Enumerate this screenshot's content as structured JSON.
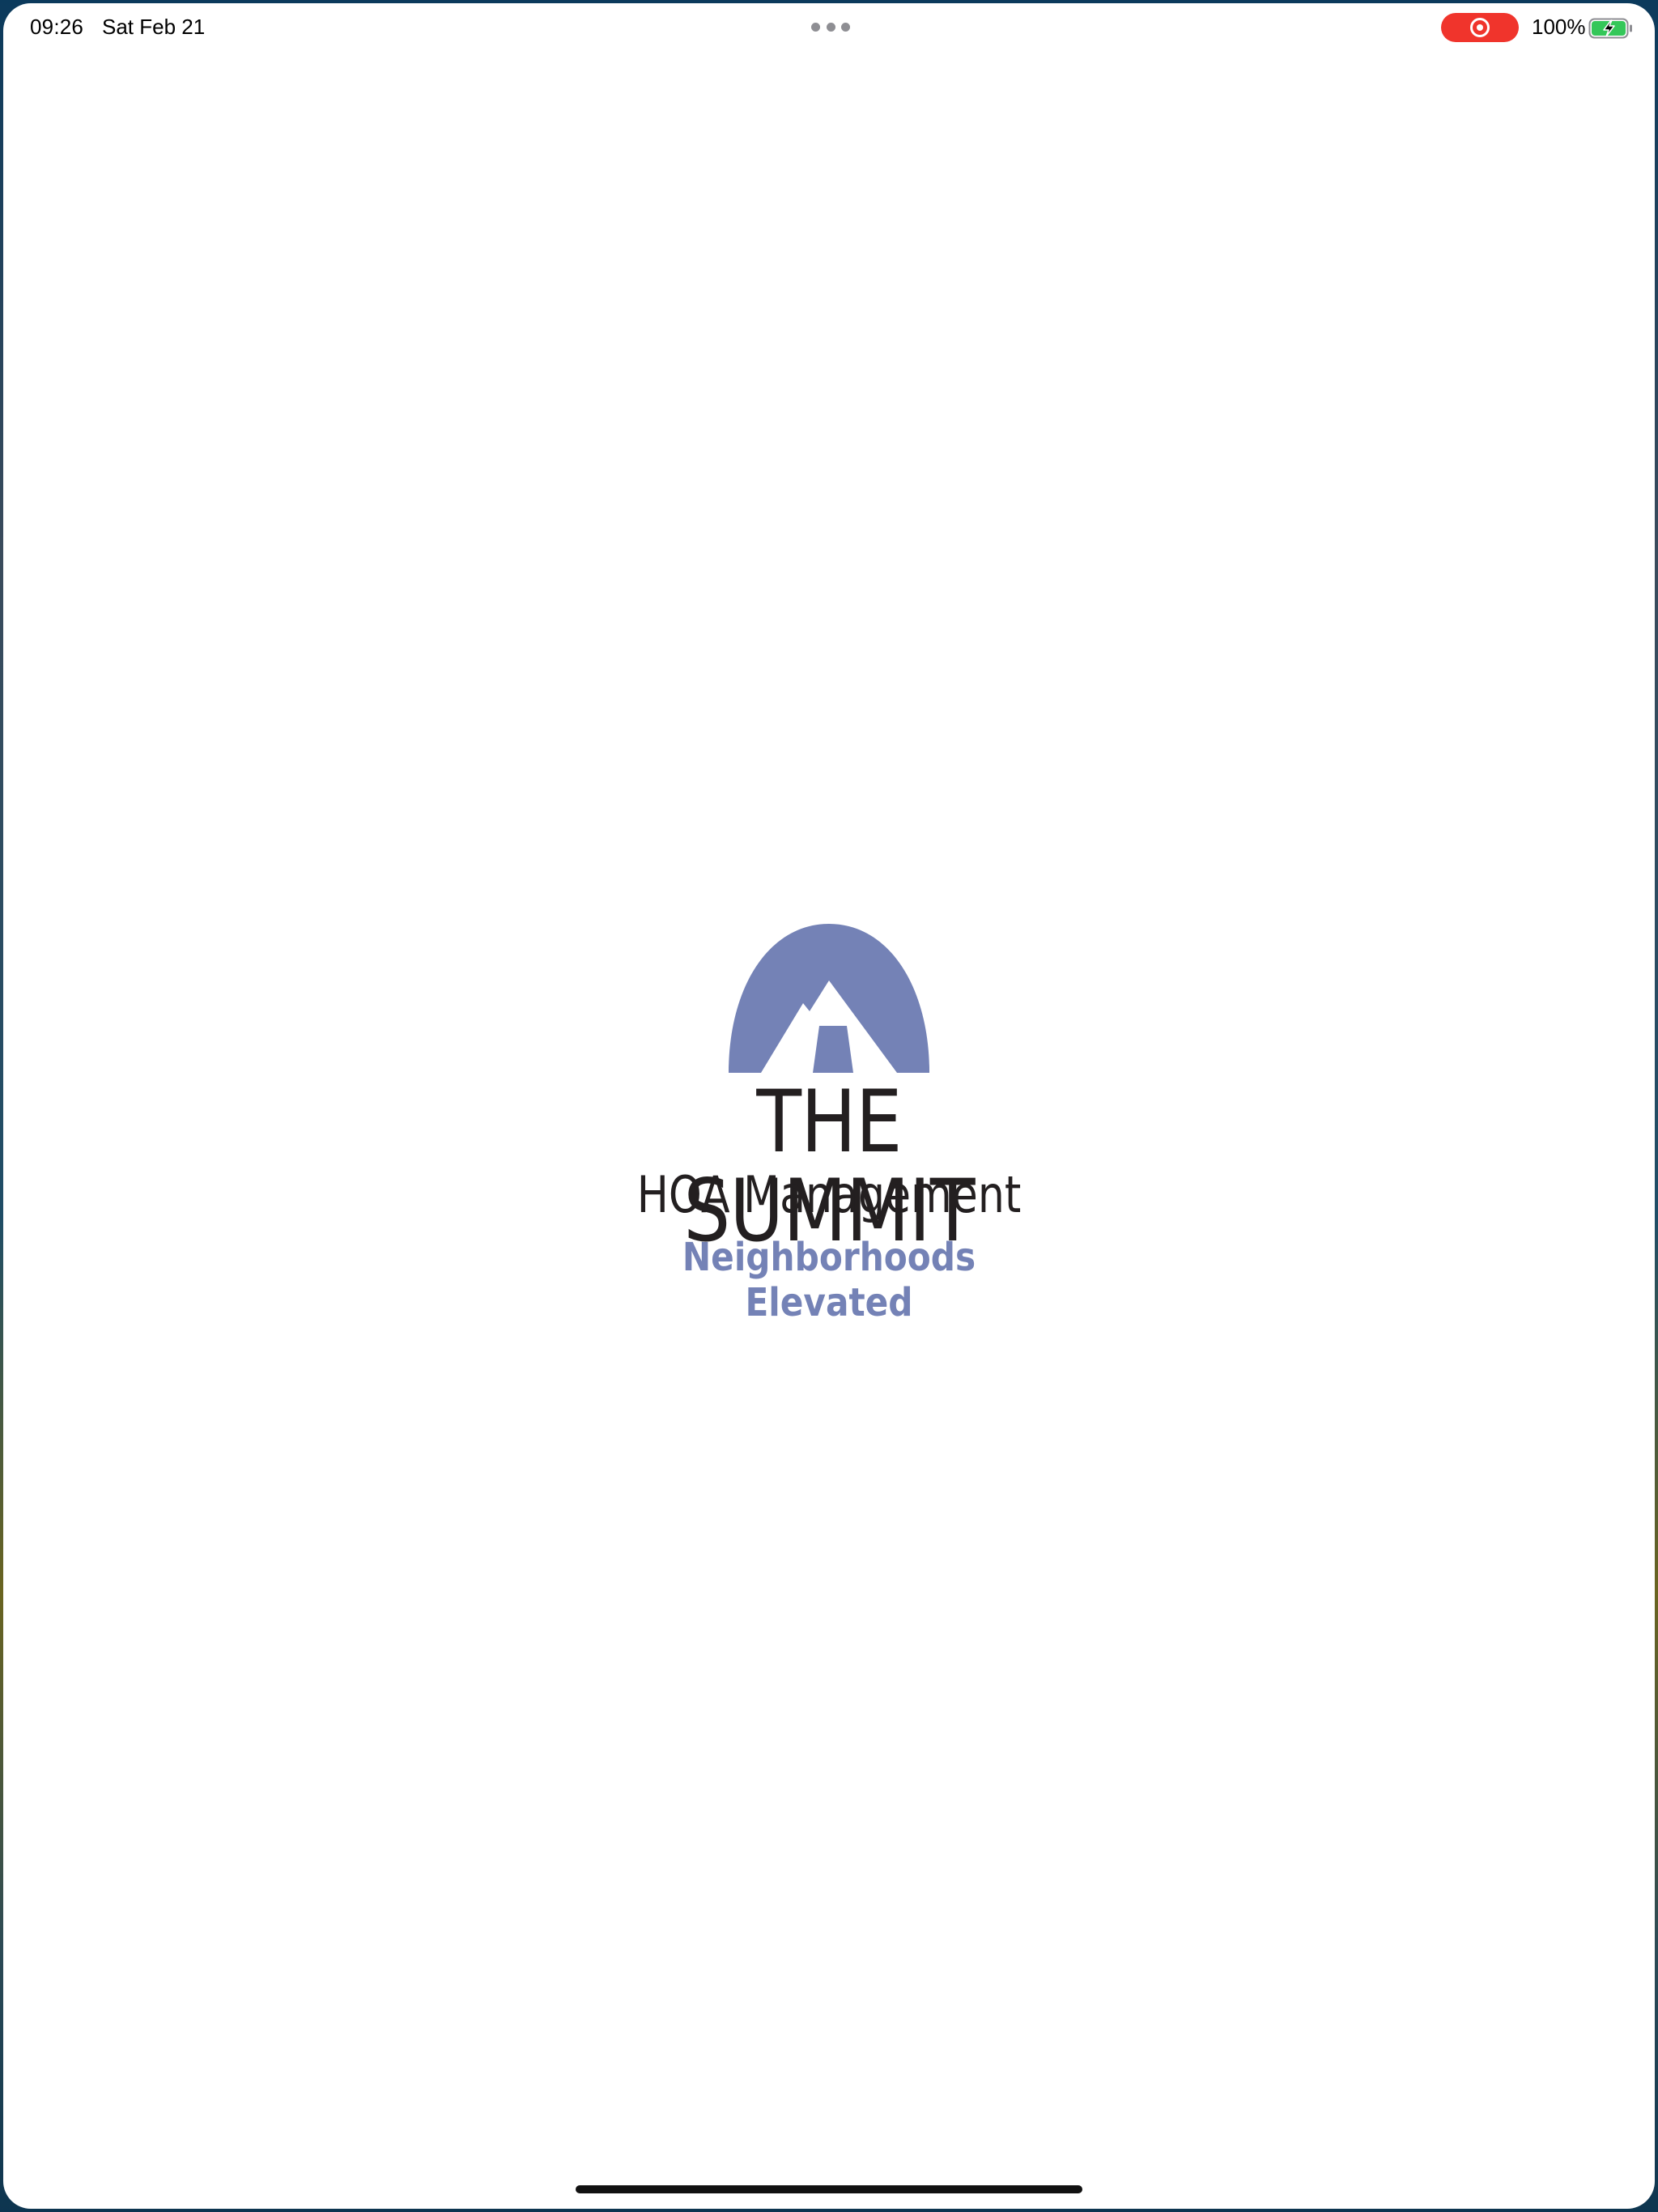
{
  "status_bar": {
    "time": "09:26",
    "date": "Sat Feb 21",
    "battery_percent": "100%",
    "battery_level": 1.0,
    "charging": true,
    "screen_recording": true,
    "icons": [
      "multitask-dots-icon",
      "screen-record-icon",
      "battery-charging-icon"
    ]
  },
  "logo": {
    "title": "THE SUMMIT",
    "subtitle": "HOA Management",
    "tagline": "Neighborhoods Elevated",
    "mark_icon": "mountain-sun-icon"
  },
  "colors": {
    "brand_blue": "#7482b6",
    "text_dark": "#231f20",
    "record_red": "#f0342c",
    "battery_green": "#34c759"
  }
}
